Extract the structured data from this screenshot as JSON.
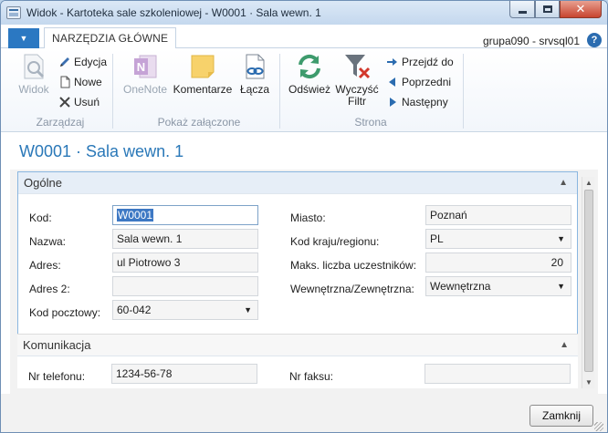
{
  "window": {
    "title": "Widok - Kartoteka sale szkoleniowej - W0001 · Sala wewn. 1",
    "close_glyph": "✕"
  },
  "ribbon": {
    "tab_label": "NARZĘDZIA GŁÓWNE",
    "menu_glyph": "▼",
    "server_info": "grupa090 - srvsql01",
    "help_glyph": "?",
    "groups": {
      "manage": {
        "label": "Zarządzaj",
        "view": "Widok",
        "edit": "Edycja",
        "new": "Nowe",
        "delete": "Usuń"
      },
      "attachments": {
        "label": "Pokaż załączone",
        "onenote": "OneNote",
        "comments": "Komentarze",
        "links": "Łącza"
      },
      "page": {
        "label": "Strona",
        "refresh": "Odśwież",
        "clear_filter_1": "Wyczyść",
        "clear_filter_2": "Filtr",
        "goto": "Przejdź do",
        "previous": "Poprzedni",
        "next": "Następny"
      }
    }
  },
  "page": {
    "title": "W0001 · Sala wewn. 1"
  },
  "general": {
    "header": "Ogólne",
    "fields": {
      "code_label": "Kod:",
      "code_value": "W0001",
      "name_label": "Nazwa:",
      "name_value": "Sala wewn. 1",
      "address_label": "Adres:",
      "address_value": "ul Piotrowo 3",
      "address2_label": "Adres 2:",
      "address2_value": "",
      "postcode_label": "Kod pocztowy:",
      "postcode_value": "60-042",
      "city_label": "Miasto:",
      "city_value": "Poznań",
      "country_label": "Kod kraju/regionu:",
      "country_value": "PL",
      "max_label": "Maks. liczba uczestników:",
      "max_value": "20",
      "type_label": "Wewnętrzna/Zewnętrzna:",
      "type_value": "Wewnętrzna"
    }
  },
  "communication": {
    "header": "Komunikacja",
    "phone_label": "Nr telefonu:",
    "phone_value": "1234-56-78",
    "fax_label": "Nr faksu:",
    "fax_value": ""
  },
  "footer": {
    "close_label": "Zamknij"
  },
  "colors": {
    "accent": "#2a78b8",
    "menu_blue": "#2b78c2",
    "selection": "#3d78c4"
  }
}
